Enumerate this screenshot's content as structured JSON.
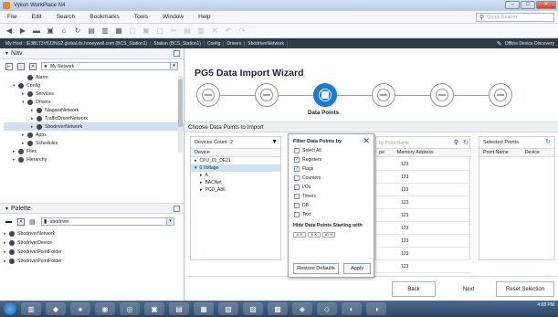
{
  "window": {
    "title": "Vykon WorkPlace N4",
    "min": "–",
    "max": "□",
    "close": "✕"
  },
  "menu": [
    "File",
    "Edit",
    "Search",
    "Bookmarks",
    "Tools",
    "Window",
    "Help"
  ],
  "quick_search": {
    "placeholder": "Quick Search"
  },
  "address": {
    "crumbs": [
      "My Host : IE3BLT3V6J2NG2.global.ds.honeywell.com (BCS_Station1)",
      "Station (BCS_Station1)",
      "Config",
      "Drivers",
      "SbodriverNetwork"
    ],
    "right_label": "Offline Device Discovery"
  },
  "nav": {
    "title": "Nav",
    "network_combo": "My Network",
    "tree": [
      {
        "label": "Alarm",
        "depth": 2,
        "expander": ""
      },
      {
        "label": "Config",
        "depth": 1,
        "expander": "▾"
      },
      {
        "label": "Services",
        "depth": 2,
        "expander": "▸"
      },
      {
        "label": "Drivers",
        "depth": 2,
        "expander": "▾"
      },
      {
        "label": "NiagaraNetwork",
        "depth": 3,
        "expander": "▸"
      },
      {
        "label": "TrafficDriverNetwork",
        "depth": 3,
        "expander": "▸"
      },
      {
        "label": "SbodriverNetwork",
        "depth": 3,
        "expander": "▸"
      },
      {
        "label": "Apps",
        "depth": 2,
        "expander": "▸"
      },
      {
        "label": "Schedules",
        "depth": 2,
        "expander": "▸"
      },
      {
        "label": "Files",
        "depth": 1,
        "expander": "▸"
      },
      {
        "label": "Hierarchy",
        "depth": 1,
        "expander": "▸"
      }
    ]
  },
  "palette": {
    "title": "Palette",
    "combo": "sbodriver",
    "items": [
      "SbodriverNetwork",
      "SbodriverDevice",
      "SbodriverPointFolder",
      "SbodriverPointFolder"
    ]
  },
  "wizard": {
    "title": "PG5 Data Import Wizard",
    "active_step_label": "Data Points",
    "active_step_index": 2,
    "step_count": 6,
    "section": "Choose Data Points to Import"
  },
  "devices": {
    "count_label": "Devices Count :2",
    "header": "Device",
    "rows": [
      {
        "label": "CPU_01_DE21",
        "indent": 0,
        "expander": "▸"
      },
      {
        "label": "0 Voltage",
        "indent": 0,
        "expander": "▾"
      },
      {
        "label": "A",
        "indent": 1,
        "expander": "▸"
      },
      {
        "label": "BACNet",
        "indent": 1,
        "expander": "▸"
      },
      {
        "label": "PCD_A86",
        "indent": 1,
        "expander": "▸"
      }
    ]
  },
  "filter": {
    "title": "Filter Data Points by",
    "close": "✕",
    "options": [
      {
        "label": "Select All",
        "checked": false
      },
      {
        "label": "Registers",
        "checked": true
      },
      {
        "label": "Flags",
        "checked": true
      },
      {
        "label": "Counters",
        "checked": false
      },
      {
        "label": "I/Os",
        "checked": false
      },
      {
        "label": "Timers",
        "checked": false
      },
      {
        "label": "DB",
        "checked": false
      },
      {
        "label": "Text",
        "checked": false
      }
    ],
    "hide_title": "Hide Data Points Starting with",
    "chips": [
      "A ✕",
      "$ ✕",
      "IO ✕"
    ],
    "restore": "Restore Defaults",
    "apply": "Apply"
  },
  "points": {
    "search_placeholder": "by Point Name",
    "col_type": "pe",
    "col_address": "Memory Address",
    "rows": [
      "123",
      "123",
      "123",
      "123",
      "123",
      "123",
      "123",
      "123",
      "123"
    ]
  },
  "selected": {
    "title": "Selected Points",
    "col_name": "Point Name",
    "col_device": "Device"
  },
  "footer": {
    "back": "Back",
    "next": "Next",
    "reset": "Reset Selection"
  },
  "taskbar": {
    "time": "4:08 PM"
  }
}
